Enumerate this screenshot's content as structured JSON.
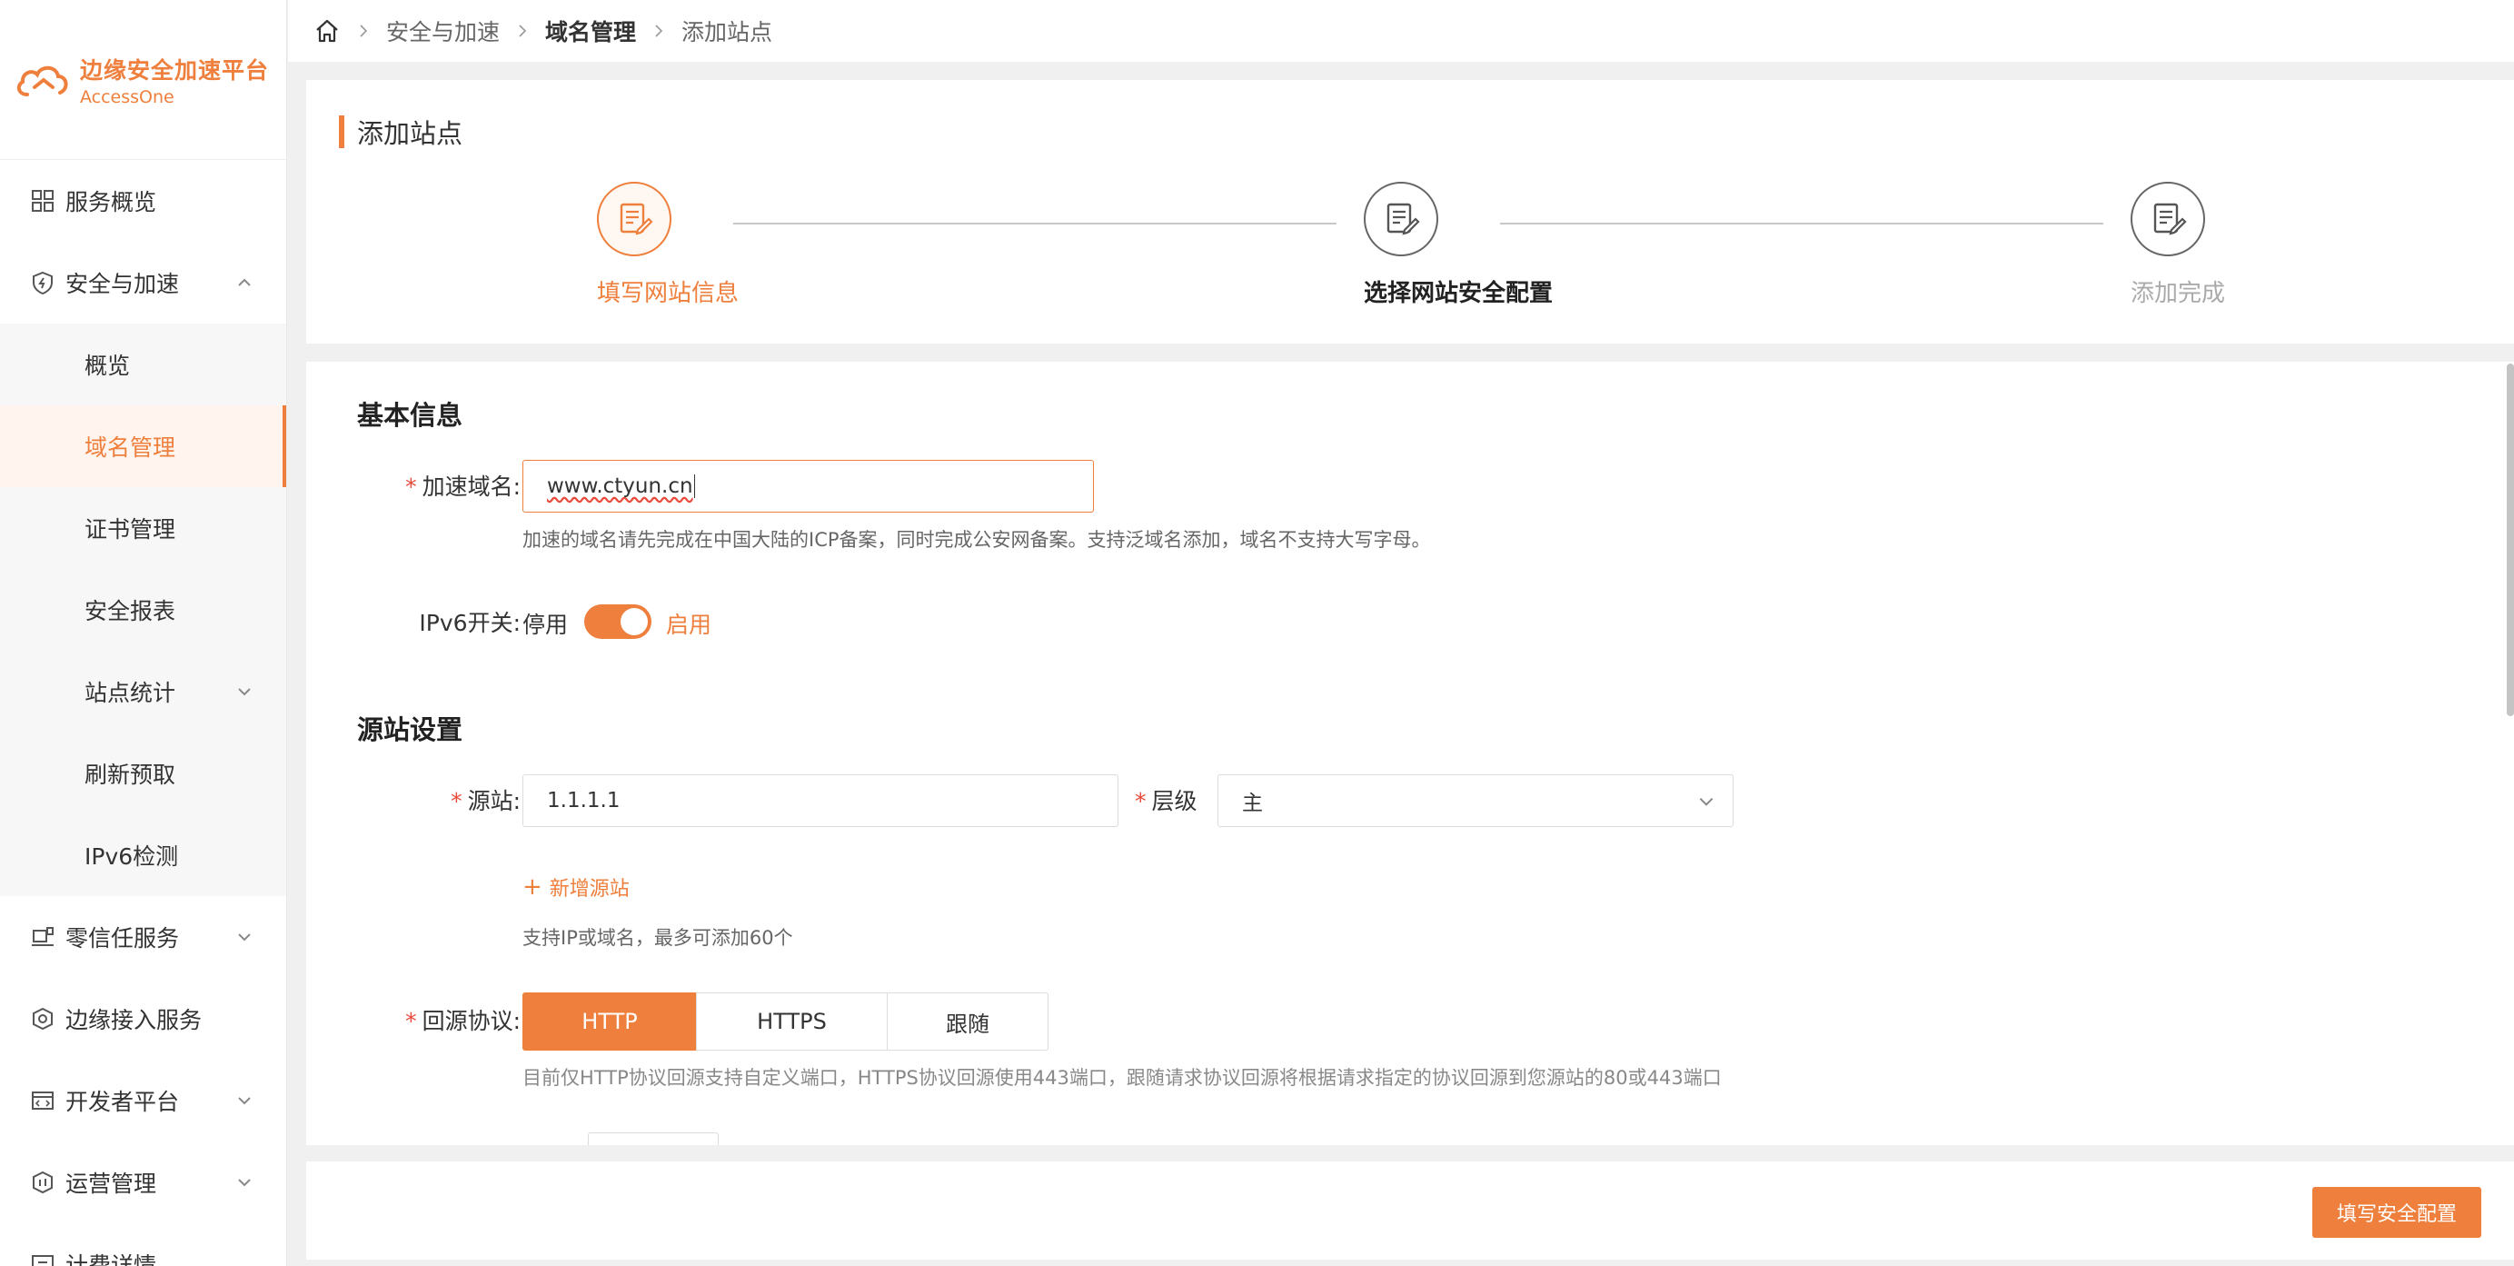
{
  "brand": {
    "title": "边缘安全加速平台",
    "subtitle": "AccessOne"
  },
  "sidebar": {
    "items": [
      {
        "label": "服务概览"
      },
      {
        "label": "安全与加速"
      },
      {
        "label": "概览"
      },
      {
        "label": "域名管理"
      },
      {
        "label": "证书管理"
      },
      {
        "label": "安全报表"
      },
      {
        "label": "站点统计"
      },
      {
        "label": "刷新预取"
      },
      {
        "label": "IPv6检测"
      },
      {
        "label": "零信任服务"
      },
      {
        "label": "边缘接入服务"
      },
      {
        "label": "开发者平台"
      },
      {
        "label": "运营管理"
      },
      {
        "label": "计费详情"
      }
    ]
  },
  "breadcrumb": [
    "安全与加速",
    "域名管理",
    "添加站点"
  ],
  "page_title": "添加站点",
  "steps": [
    {
      "label": "填写网站信息",
      "state": "done"
    },
    {
      "label": "选择网站安全配置",
      "state": "current"
    },
    {
      "label": "添加完成",
      "state": "pending"
    }
  ],
  "basic": {
    "section": "基本信息",
    "domain_label": "加速域名:",
    "domain_value": "www.ctyun.cn",
    "domain_hint": "加速的域名请先完成在中国大陆的ICP备案，同时完成公安网备案。支持泛域名添加，域名不支持大写字母。",
    "ipv6_label": "IPv6开关:",
    "ipv6_off": "停用",
    "ipv6_on": "启用"
  },
  "origin": {
    "section": "源站设置",
    "origin_label": "源站:",
    "origin_value": "1.1.1.1",
    "level_label": "层级",
    "level_value": "主",
    "add_origin": "新增源站",
    "origin_hint": "支持IP或域名，最多可添加60个",
    "protocol_label": "回源协议:",
    "protocols": [
      "HTTP",
      "HTTPS",
      "跟随"
    ],
    "protocol_selected": "HTTP",
    "protocol_hint": "目前仅HTTP协议回源支持自定义端口，HTTPS协议回源使用443端口，跟随请求协议回源将根据请求指定的协议回源到您源站的80或443端口"
  },
  "footer": {
    "next_button": "填写安全配置"
  },
  "colors": {
    "accent": "#ee7f3c",
    "required": "#e84a3b"
  }
}
